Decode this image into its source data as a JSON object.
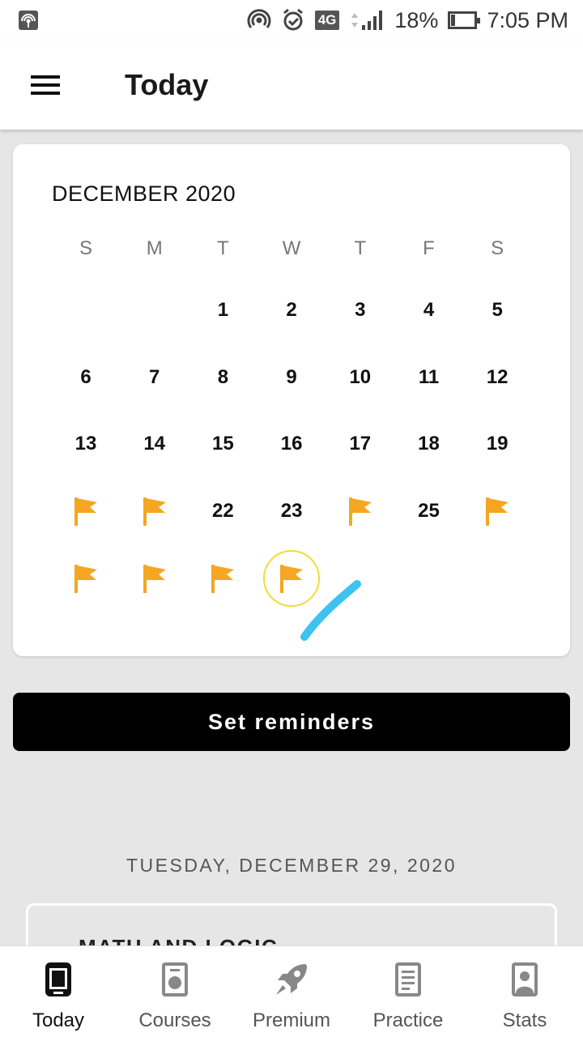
{
  "status_bar": {
    "network_type": "4G",
    "battery": "18%",
    "time": "7:05 PM",
    "icons": [
      "hotspot-icon",
      "cast-icon",
      "alarm-icon",
      "signal-icon",
      "battery-icon"
    ]
  },
  "app_bar": {
    "title": "Today",
    "menu_icon": "hamburger-menu-icon"
  },
  "calendar": {
    "month_label": "DECEMBER 2020",
    "weekdays": [
      "S",
      "M",
      "T",
      "W",
      "T",
      "F",
      "S"
    ],
    "first_weekday_index": 2,
    "days_shown": 30,
    "flagged_days": [
      20,
      21,
      24,
      26,
      27,
      28,
      29,
      30
    ],
    "today": 30,
    "flag_color": "#f5a623",
    "today_ring_color": "#efdc37"
  },
  "reminder_button": {
    "label": "Set reminders"
  },
  "selected_date": "TUESDAY, DECEMBER 29, 2020",
  "course_card": {
    "title": "MATH AND LOGIC"
  },
  "bottom_nav": {
    "items": [
      {
        "label": "Today",
        "icon": "today-icon",
        "active": true
      },
      {
        "label": "Courses",
        "icon": "courses-icon",
        "active": false
      },
      {
        "label": "Premium",
        "icon": "rocket-icon",
        "active": false
      },
      {
        "label": "Practice",
        "icon": "practice-icon",
        "active": false
      },
      {
        "label": "Stats",
        "icon": "stats-icon",
        "active": false
      }
    ]
  }
}
